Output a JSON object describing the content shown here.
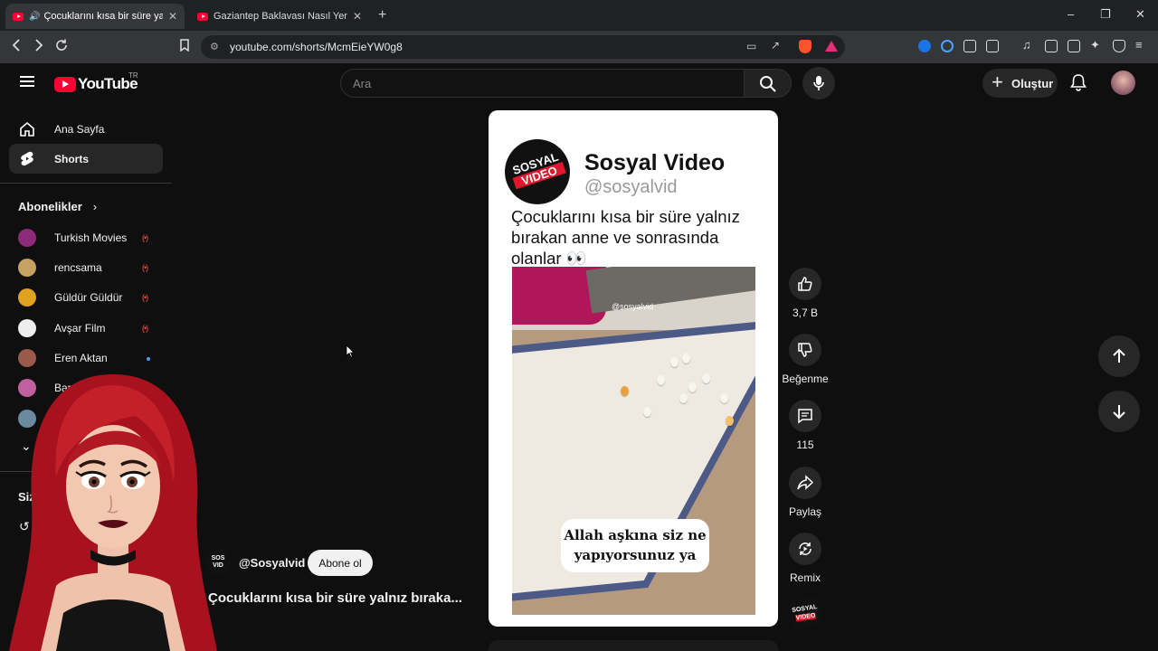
{
  "browser": {
    "tabs": [
      {
        "title": "Çocuklarını kısa bir süre yalnız",
        "active": true
      },
      {
        "title": "Gaziantep Baklavası Nasıl Yenir ? - Ke",
        "active": false
      }
    ],
    "url": "youtube.com/shorts/McmEieYW0g8"
  },
  "header": {
    "logo_text": "YouTube",
    "region": "TR",
    "search_placeholder": "Ara",
    "create_label": "Oluştur"
  },
  "sidebar": {
    "items": [
      {
        "label": "Ana Sayfa",
        "icon": "home-icon"
      },
      {
        "label": "Shorts",
        "icon": "shorts-icon",
        "selected": true
      }
    ],
    "subscriptions_title": "Abonelikler",
    "subscriptions": [
      {
        "name": "Turkish Movies",
        "status": "live",
        "color": "#8e2a7a"
      },
      {
        "name": "rencsama",
        "status": "live",
        "color": "#c8a060"
      },
      {
        "name": "Güldür Güldür",
        "status": "live",
        "color": "#e0a020"
      },
      {
        "name": "Avşar Film",
        "status": "live",
        "color": "#eeeeee"
      },
      {
        "name": "Eren Aktan",
        "status": "new",
        "color": "#9a5a4a"
      },
      {
        "name": "Bar",
        "status": "",
        "color": "#c060a0"
      }
    ],
    "you_title": "Siz"
  },
  "video": {
    "brand_name": "Sosyal Video",
    "brand_handle": "@sosyalvid",
    "logo_line1": "SOSYAL",
    "logo_line2": "VIDEO",
    "headline": "Çocuklarını kısa bir süre yalnız bırakan anne ve sonrasında olanlar 👀",
    "watermark": "@sosyalvid",
    "caption_line1": "Allah aşkına siz ne",
    "caption_line2": "yapıyorsunuz ya"
  },
  "channel": {
    "name": "@Sosyalvid",
    "subscribe_label": "Abone ol",
    "short_title": "Çocuklarını kısa bir süre yalnız bıraka..."
  },
  "actions": {
    "likes": "3,7 B",
    "dislike_label": "Beğenme",
    "comments": "115",
    "share_label": "Paylaş",
    "remix_label": "Remix"
  },
  "colors": {
    "background": "#0f0f0f",
    "youtube_red": "#ff0033",
    "live_red": "#ff4e45",
    "rug_border": "#4d5a86",
    "couch": "#b0165a"
  }
}
